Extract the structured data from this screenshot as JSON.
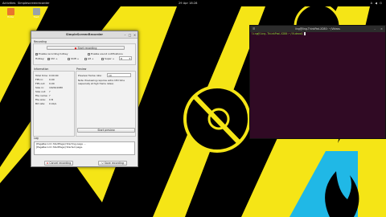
{
  "topbar": {
    "activities": "Activities",
    "app": "Simplescreenrecorder",
    "clock": "29 Apr 18:28",
    "sys_icons": "A ◀ ⏻"
  },
  "desktop_icons": [
    {
      "label": "Home"
    },
    {
      "label": "Trash"
    }
  ],
  "colors": {
    "wallpaper_yellow": "#f5e516",
    "wallpaper_black": "#000000",
    "wallpaper_cyan": "#20b8e6",
    "terminal_bg": "#300a24"
  },
  "ssr": {
    "title": "SimpleScreenRecorder",
    "recording_group": "Recording",
    "start_recording": "Start recording",
    "enable_hotkey": "Enable recording hotkey",
    "enable_sound": "Enable sound notifications",
    "hotkey_label": "Hotkey:",
    "mod_ctrl": "Ctrl +",
    "mod_shift": "Shift +",
    "mod_alt": "Alt +",
    "mod_super": "Super +",
    "key": "R",
    "information_group": "Information",
    "info": [
      {
        "key": "Total time:",
        "value": "0:00:00"
      },
      {
        "key": "FPS in:",
        "value": "0.00"
      },
      {
        "key": "FPS out:",
        "value": "0.00"
      },
      {
        "key": "Size in:",
        "value": "1920x1080"
      },
      {
        "key": "Size out:",
        "value": "?"
      },
      {
        "key": "File name:",
        "value": "?"
      },
      {
        "key": "File size:",
        "value": "0 B"
      },
      {
        "key": "Bit rate:",
        "value": "0 kb/s"
      }
    ],
    "preview_group": "Preview",
    "preview_frame_rate_label": "Preview frame rate:",
    "preview_frame_rate": "10",
    "preview_note": "Note: Previewing requires extra CPU time (especially at high frame rates).",
    "start_preview": "Start preview",
    "log_group": "Log",
    "log_lines": [
      "[PageRecord::StartPage] Starting page ...",
      "[PageRecord::StartPage] Started page."
    ],
    "cancel_recording": "Cancel recording",
    "save_recording": "Save recording"
  },
  "terminal": {
    "title": "ling@ling-ThinkPad-X280: ~/Videos",
    "prompt": "ling@ling-ThinkPad-X280:~/Videos$"
  }
}
